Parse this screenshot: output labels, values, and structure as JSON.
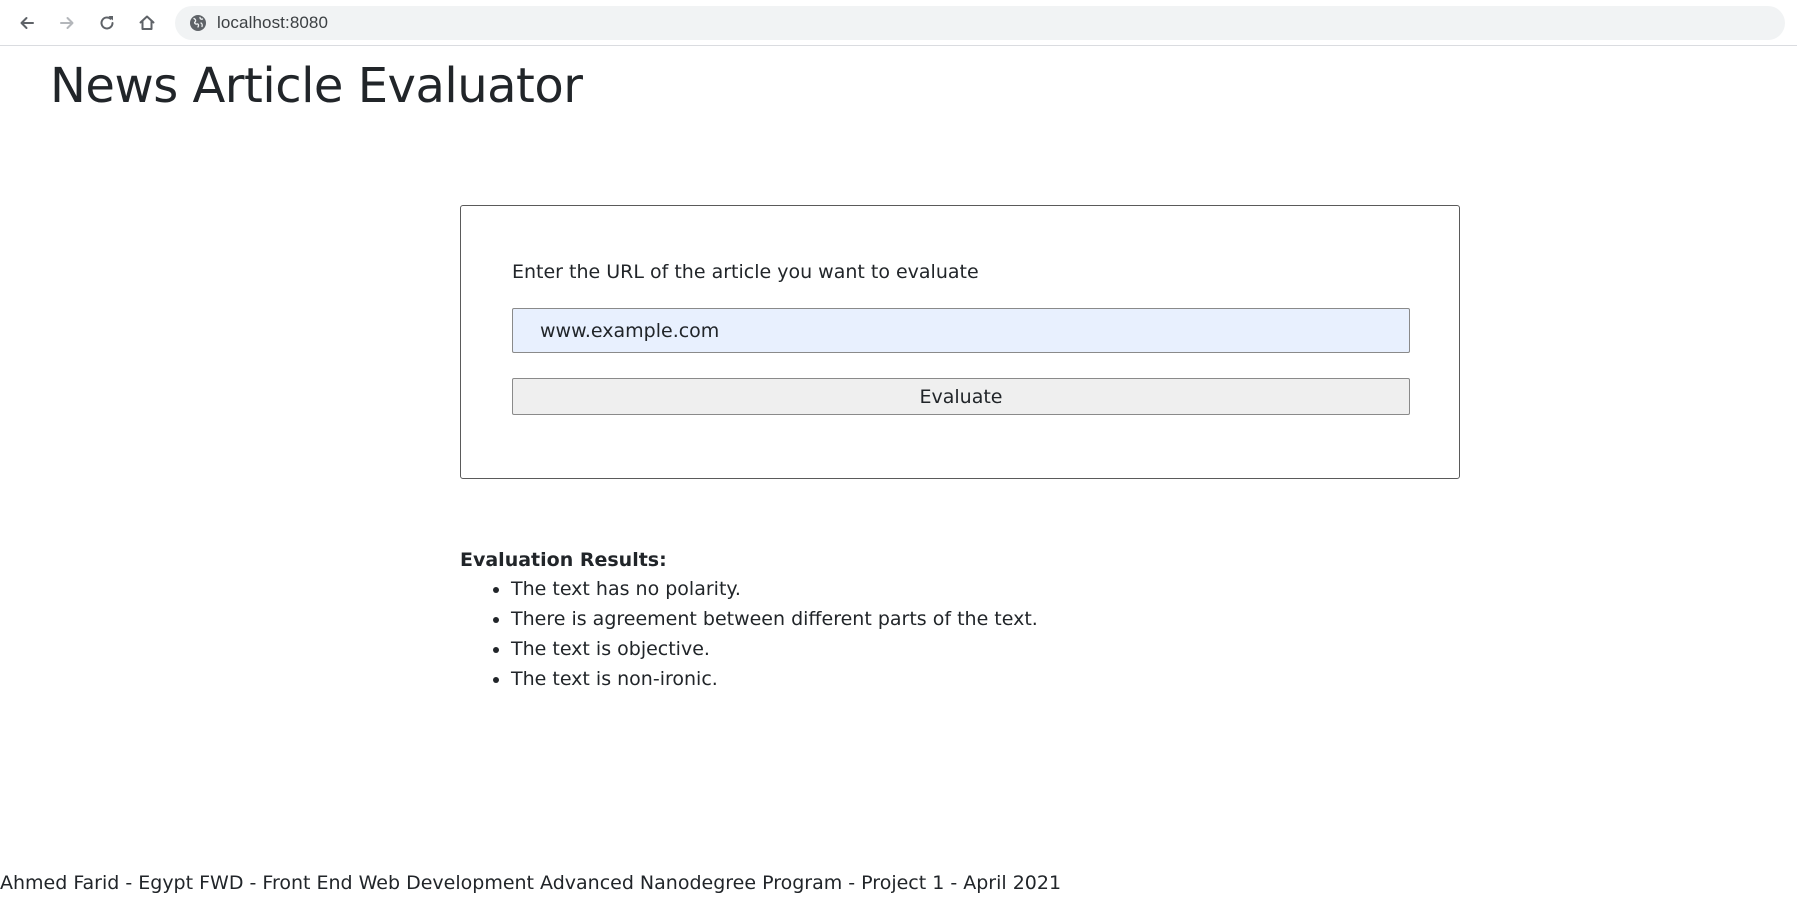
{
  "browser": {
    "url": "localhost:8080"
  },
  "page": {
    "title": "News Article Evaluator"
  },
  "form": {
    "label": "Enter the URL of the article you want to evaluate",
    "input_value": "www.example.com",
    "button_label": "Evaluate"
  },
  "results": {
    "heading": "Evaluation Results:",
    "items": [
      "The text has no polarity.",
      "There is agreement between different parts of the text.",
      "The text is objective.",
      "The text is non-ironic."
    ]
  },
  "footer": {
    "text": "Ahmed Farid - Egypt FWD - Front End Web Development Advanced Nanodegree Program - Project 1 - April 2021"
  },
  "icons": {
    "back": "arrow-left-icon",
    "forward": "arrow-right-icon",
    "reload": "reload-icon",
    "home": "home-icon",
    "site": "globe-icon"
  },
  "colors": {
    "input_autofill_bg": "#e8f0fe",
    "button_bg": "#efefef",
    "omnibox_bg": "#f1f3f4"
  }
}
